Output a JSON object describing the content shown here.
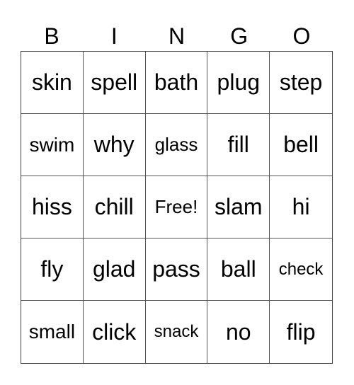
{
  "header": [
    "B",
    "I",
    "N",
    "G",
    "O"
  ],
  "rows": [
    [
      "skin",
      "spell",
      "bath",
      "plug",
      "step"
    ],
    [
      "swim",
      "why",
      "glass",
      "fill",
      "bell"
    ],
    [
      "hiss",
      "chill",
      "Free!",
      "slam",
      "hi"
    ],
    [
      "fly",
      "glad",
      "pass",
      "ball",
      "check"
    ],
    [
      "small",
      "click",
      "snack",
      "no",
      "flip"
    ]
  ]
}
